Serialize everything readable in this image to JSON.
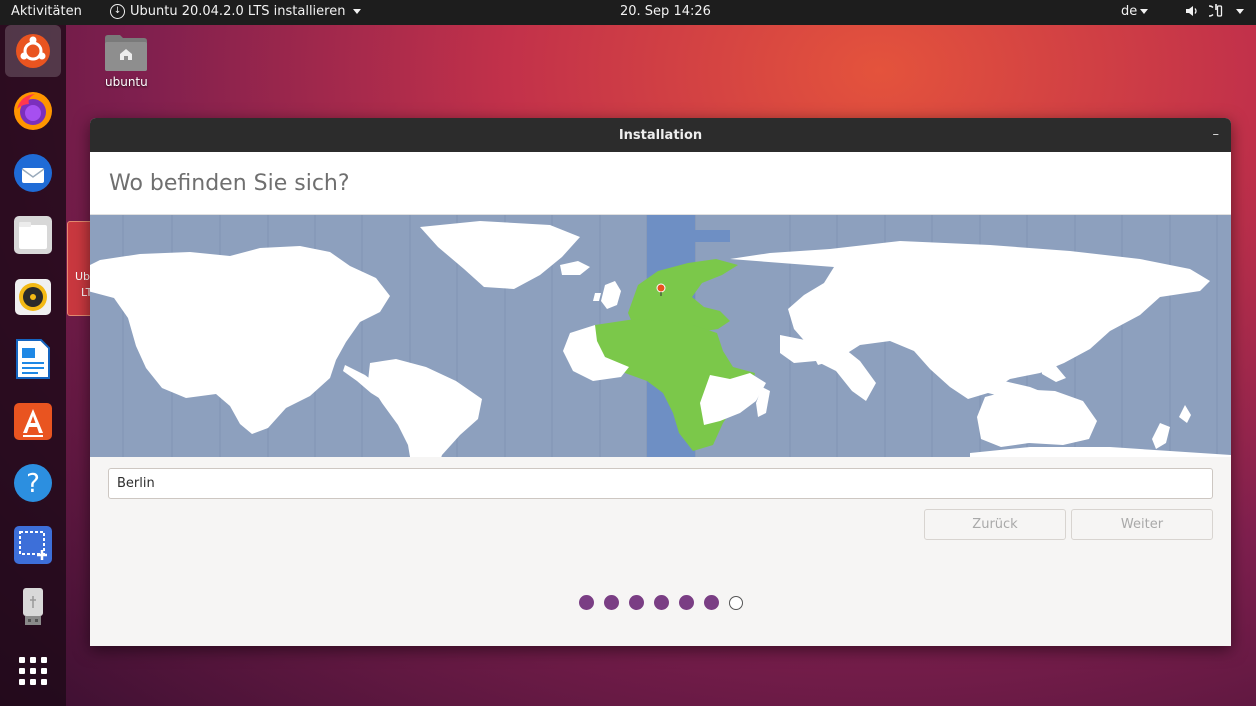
{
  "topbar": {
    "activities": "Aktivitäten",
    "app_menu": "Ubuntu 20.04.2.0 LTS installieren",
    "clock": "20. Sep  14:26",
    "keyboard_layout": "de"
  },
  "desktop": {
    "home_folder_label": "ubuntu",
    "behind_window_label_1": "Ub",
    "behind_window_label_2": "LT"
  },
  "dock": {
    "items": [
      "ubuntu-installer",
      "firefox",
      "thunderbird",
      "files",
      "rhythmbox",
      "libreoffice-writer",
      "software-center",
      "help",
      "screenshot",
      "usb-drive",
      "show-apps"
    ]
  },
  "window": {
    "title": "Installation",
    "minimize": "–",
    "page_title": "Wo befinden Sie sich?",
    "timezone_value": "Berlin",
    "back_label": "Zurück",
    "next_label": "Weiter",
    "progress": {
      "filled": 6,
      "total": 7
    }
  },
  "colors": {
    "accent": "#7a3e84",
    "map_ocean": "#8da0be",
    "map_land": "#ffffff",
    "map_highlight": "#7bc84a",
    "tz_band": "#6e8fc4"
  }
}
